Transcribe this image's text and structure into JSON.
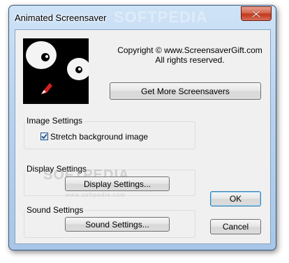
{
  "window": {
    "title": "Animated Screensaver"
  },
  "header": {
    "copyright_line1": "Copyright © www.ScreensaverGift.com",
    "copyright_line2": "All rights reserved.",
    "get_more_label": "Get More Screensavers"
  },
  "image_settings": {
    "group_label": "Image Settings",
    "stretch_label": "Stretch background image",
    "stretch_checked": true
  },
  "display_settings": {
    "group_label": "Display Settings",
    "button_label": "Display Settings..."
  },
  "sound_settings": {
    "group_label": "Sound Settings",
    "button_label": "Sound Settings..."
  },
  "buttons": {
    "ok_label": "OK",
    "cancel_label": "Cancel"
  },
  "watermark": {
    "main": "SOFTPEDIA",
    "url": "www.softpedia.com"
  },
  "colors": {
    "title_bar": "#b9d3ef",
    "close_button": "#c0371b",
    "client_bg": "#f0f0f0"
  }
}
